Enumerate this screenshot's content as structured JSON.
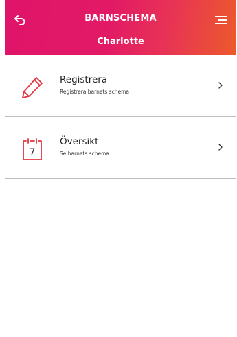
{
  "header": {
    "title": "BARNSCHEMA",
    "child_name": "Charlotte",
    "back_icon": "back-arrow-icon",
    "menu_icon": "hamburger-menu-icon"
  },
  "menu": {
    "items": [
      {
        "title": "Registrera",
        "subtitle": "Registrera barnets schema",
        "icon": "pencil-icon"
      },
      {
        "title": "Översikt",
        "subtitle": "Se barnets schema",
        "icon": "calendar-icon",
        "icon_text": "7"
      }
    ]
  },
  "colors": {
    "header_start": "#e0146a",
    "header_end": "#ec5a2c",
    "icon_accent": "#e2363f"
  }
}
